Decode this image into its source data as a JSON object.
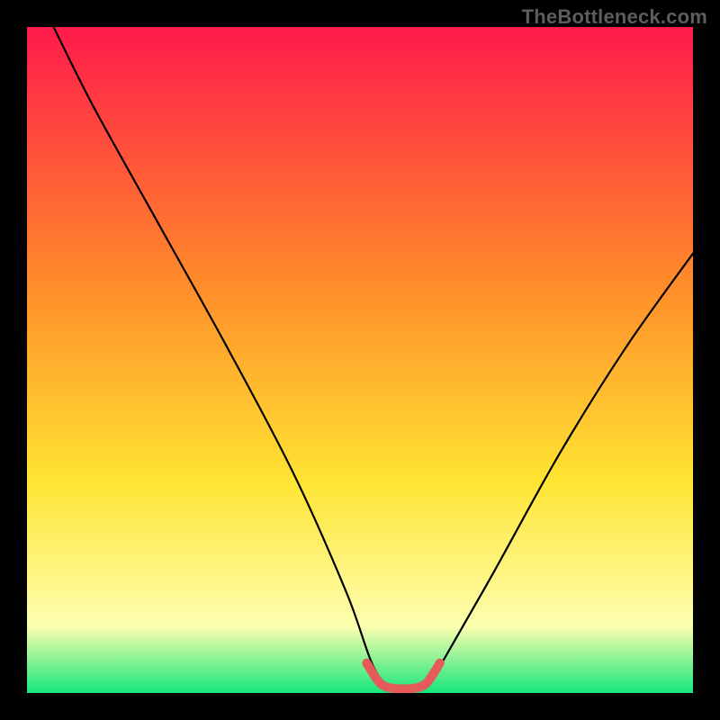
{
  "watermark": "TheBottleneck.com",
  "colors": {
    "frame": "#000000",
    "grad_top": "#ff1a4b",
    "grad_mid1": "#ff8a2a",
    "grad_mid2": "#ffe432",
    "grad_low": "#fdffb0",
    "grad_bottom": "#15e67a",
    "curve": "#000000",
    "marker": "#e65a5a"
  },
  "chart_data": {
    "type": "line",
    "title": "",
    "xlabel": "",
    "ylabel": "",
    "xlim": [
      0,
      100
    ],
    "ylim": [
      0,
      100
    ],
    "series": [
      {
        "name": "curve",
        "x": [
          4,
          10,
          20,
          30,
          40,
          48,
          52,
          55,
          58,
          60,
          62,
          70,
          80,
          90,
          100
        ],
        "y": [
          100,
          88,
          70,
          52,
          33,
          15,
          4,
          0.5,
          0.5,
          1,
          4,
          18,
          36,
          52,
          66
        ]
      },
      {
        "name": "minimum-band",
        "x": [
          51,
          53,
          55,
          58,
          60,
          62
        ],
        "y": [
          4.5,
          1.5,
          0.7,
          0.7,
          1.5,
          4.5
        ]
      }
    ],
    "annotations": []
  }
}
